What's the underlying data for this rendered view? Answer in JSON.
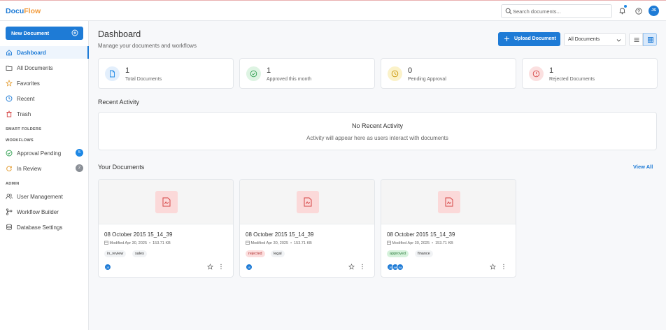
{
  "app": {
    "logo_part1": "Docu",
    "logo_part2": "Flow"
  },
  "header": {
    "search_placeholder": "Search documents...",
    "user_initials": "JS"
  },
  "sidebar": {
    "new_document_label": "New Document",
    "items": [
      {
        "label": "Dashboard",
        "icon": "home-icon",
        "active": true
      },
      {
        "label": "All Documents",
        "icon": "folder-icon"
      },
      {
        "label": "Favorites",
        "icon": "star-icon"
      },
      {
        "label": "Recent",
        "icon": "clock-icon"
      },
      {
        "label": "Trash",
        "icon": "trash-icon"
      }
    ],
    "smart_folders_label": "SMART FOLDERS",
    "workflows_label": "WORKFLOWS",
    "workflows": [
      {
        "label": "Approval Pending",
        "icon": "check-circle-icon",
        "badge": "5",
        "badge_color": "#1e88e5"
      },
      {
        "label": "In Review",
        "icon": "refresh-icon",
        "badge": "2",
        "badge_color": "#8a8f96"
      }
    ],
    "admin_label": "ADMIN",
    "admin": [
      {
        "label": "User Management",
        "icon": "users-icon"
      },
      {
        "label": "Workflow Builder",
        "icon": "workflow-icon"
      },
      {
        "label": "Database Settings",
        "icon": "database-icon"
      }
    ]
  },
  "main": {
    "title": "Dashboard",
    "subtitle": "Manage your documents and workflows",
    "upload_label": "Upload Document",
    "filter_value": "All Documents",
    "stats": [
      {
        "value": "1",
        "label": "Total Documents",
        "color": "#1e88e5"
      },
      {
        "value": "1",
        "label": "Approved this month",
        "color": "#2e9e4f"
      },
      {
        "value": "0",
        "label": "Pending Approval",
        "color": "#d9a400"
      },
      {
        "value": "1",
        "label": "Rejected Documents",
        "color": "#d64545"
      }
    ],
    "recent_activity_title": "Recent Activity",
    "no_activity_title": "No Recent Activity",
    "no_activity_sub": "Activity will appear here as users interact with documents",
    "your_documents_title": "Your Documents",
    "view_all_label": "View All",
    "documents": [
      {
        "name": "08 October 2015 15_14_39",
        "modified": "Modified Apr 30, 2025",
        "size": "153.71 KB",
        "tags": [
          "in_review",
          "sales"
        ],
        "avatars": [
          "JS"
        ]
      },
      {
        "name": "08 October 2015 15_14_39",
        "modified": "Modified Apr 30, 2025",
        "size": "153.71 KB",
        "tags": [
          "rejected",
          "legal"
        ],
        "avatars": [
          "JS"
        ]
      },
      {
        "name": "08 October 2015 15_14_39",
        "modified": "Modified Apr 30, 2025",
        "size": "153.71 KB",
        "tags": [
          "approved",
          "finance"
        ],
        "avatars": [
          "JS",
          "AK",
          "JW"
        ]
      }
    ]
  }
}
